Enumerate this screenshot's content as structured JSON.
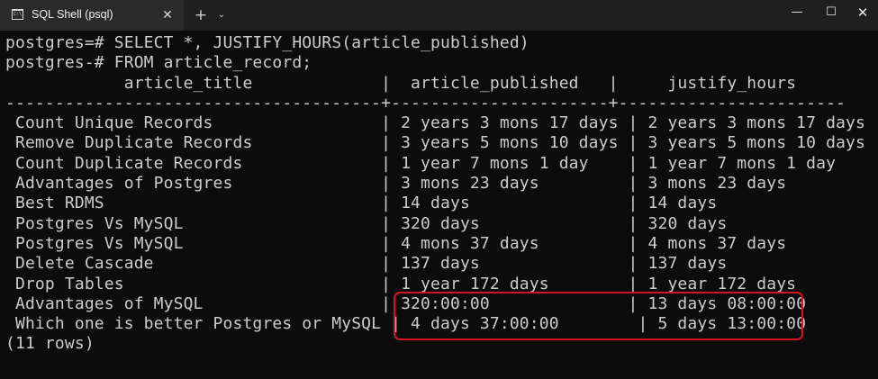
{
  "window": {
    "tab_title": "SQL Shell (psql)",
    "tab_icon": "terminal-icon",
    "close_tab_glyph": "✕",
    "new_tab_glyph": "+",
    "tab_menu_glyph": "⌄",
    "minimize_glyph": "—",
    "maximize_glyph": "☐",
    "close_glyph": "✕"
  },
  "terminal": {
    "prompt_line_1": "postgres=# SELECT *, JUSTIFY_HOURS(article_published)",
    "prompt_line_2": "postgres-# FROM article_record;",
    "header_line": "            article_title             |  article_published   |     justify_hours",
    "separator_line": "--------------------------------------+----------------------+-----------------------",
    "rows": [
      " Count Unique Records                 | 2 years 3 mons 17 days | 2 years 3 mons 17 days",
      " Remove Duplicate Records             | 3 years 5 mons 10 days | 3 years 5 mons 10 days",
      " Count Duplicate Records              | 1 year 7 mons 1 day    | 1 year 7 mons 1 day",
      " Advantages of Postgres               | 3 mons 23 days         | 3 mons 23 days",
      " Best RDMS                            | 14 days                | 14 days",
      " Postgres Vs MySQL                    | 320 days               | 320 days",
      " Postgres Vs MySQL                    | 4 mons 37 days         | 4 mons 37 days",
      " Delete Cascade                       | 137 days               | 137 days",
      " Drop Tables                          | 1 year 172 days        | 1 year 172 days",
      " Advantages of MySQL                  | 320:00:00              | 13 days 08:00:00",
      " Which one is better Postgres or MySQL | 4 days 37:00:00        | 5 days 13:00:00"
    ],
    "footer_line": "(11 rows)"
  },
  "colors": {
    "background": "#0c0c0c",
    "text": "#cccccc",
    "highlight_border": "#d4151f"
  }
}
